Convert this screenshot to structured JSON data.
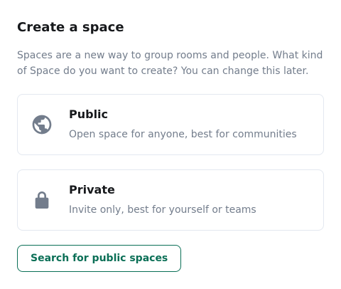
{
  "dialog": {
    "title": "Create a space",
    "description": "Spaces are a new way to group rooms and people. What kind of Space do you want to create? You can change this later."
  },
  "options": [
    {
      "title": "Public",
      "description": "Open space for anyone, best for communities",
      "icon": "globe-icon"
    },
    {
      "title": "Private",
      "description": "Invite only, best for yourself or teams",
      "icon": "lock-icon"
    }
  ],
  "actions": {
    "search_label": "Search for public spaces"
  },
  "colors": {
    "accent": "#0a6f56",
    "icon": "#737d8c",
    "border": "#e3e8f0",
    "text_primary": "#17191c",
    "text_secondary": "#737d8c"
  }
}
